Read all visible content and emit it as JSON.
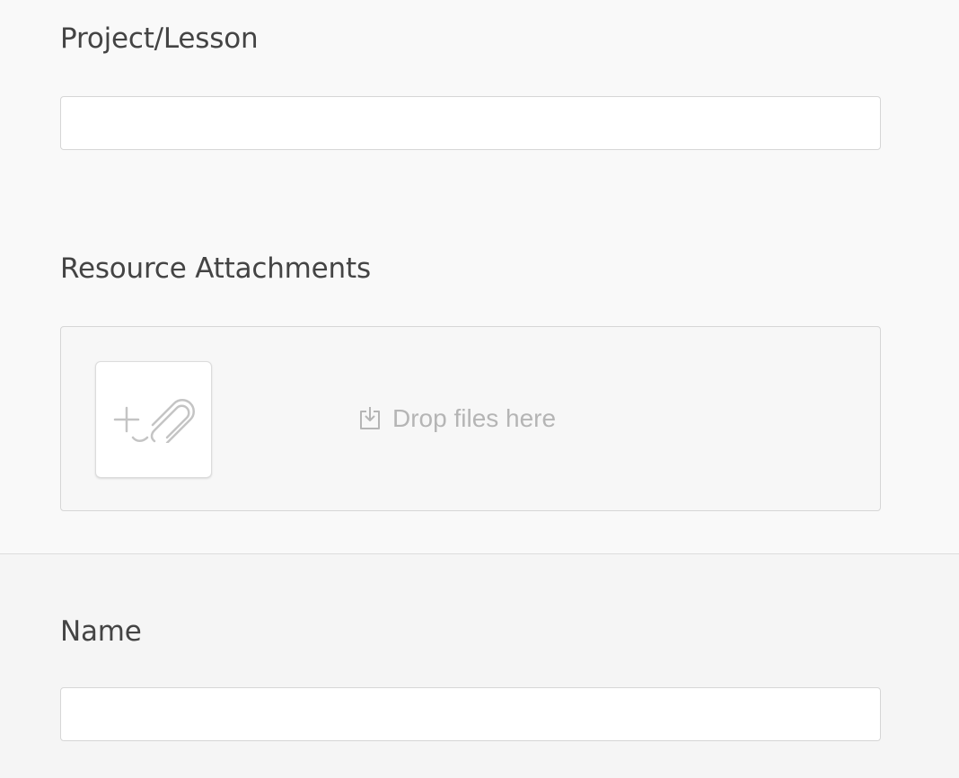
{
  "form": {
    "project_lesson": {
      "label": "Project/Lesson",
      "value": "",
      "placeholder": ""
    },
    "resource_attachments": {
      "label": "Resource Attachments",
      "attach_icon": "plus-paperclip-icon",
      "drop_icon": "download-tray-icon",
      "drop_hint": "Drop files here"
    },
    "name": {
      "label": "Name",
      "value": "",
      "placeholder": ""
    }
  },
  "colors": {
    "background_top": "#f9f9f9",
    "background_bottom": "#f5f5f5",
    "label_text": "#444444",
    "border": "#d6d6d6",
    "muted_icon": "#c4c4c4"
  }
}
